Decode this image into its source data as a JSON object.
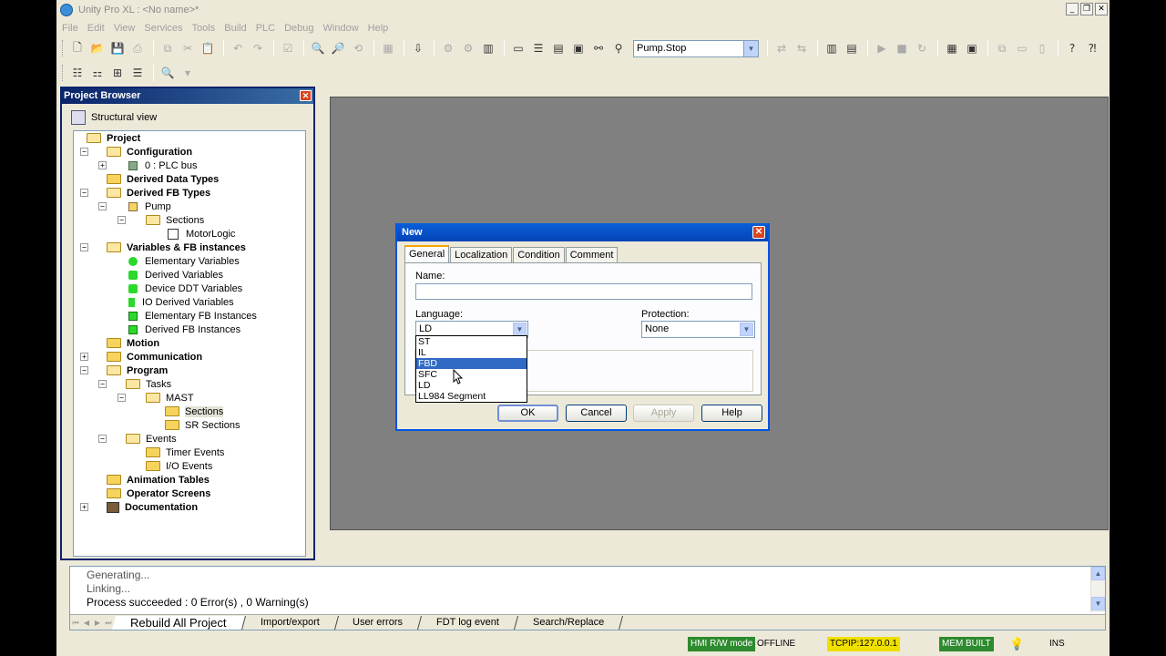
{
  "window": {
    "title": "Unity Pro XL : <No name>*"
  },
  "menu": [
    "File",
    "Edit",
    "View",
    "Services",
    "Tools",
    "Build",
    "PLC",
    "Debug",
    "Window",
    "Help"
  ],
  "toolbar": {
    "combo_value": "Pump.Stop"
  },
  "project_browser": {
    "title": "Project Browser",
    "view_label": "Structural view",
    "tree": [
      {
        "label": "Project",
        "bold": true
      },
      {
        "label": "Configuration",
        "bold": true
      },
      {
        "label": "0 : PLC bus",
        "bold": false
      },
      {
        "label": "Derived Data Types",
        "bold": true
      },
      {
        "label": "Derived FB Types",
        "bold": true
      },
      {
        "label": "Pump",
        "bold": false
      },
      {
        "label": "Sections",
        "bold": false
      },
      {
        "label": "MotorLogic",
        "bold": false
      },
      {
        "label": "Variables & FB instances",
        "bold": true
      },
      {
        "label": "Elementary Variables",
        "bold": false
      },
      {
        "label": "Derived Variables",
        "bold": false
      },
      {
        "label": "Device DDT Variables",
        "bold": false
      },
      {
        "label": "IO Derived Variables",
        "bold": false
      },
      {
        "label": "Elementary FB Instances",
        "bold": false
      },
      {
        "label": "Derived FB Instances",
        "bold": false
      },
      {
        "label": "Motion",
        "bold": true
      },
      {
        "label": "Communication",
        "bold": true
      },
      {
        "label": "Program",
        "bold": true
      },
      {
        "label": "Tasks",
        "bold": false
      },
      {
        "label": "MAST",
        "bold": false
      },
      {
        "label": "Sections",
        "bold": false
      },
      {
        "label": "SR Sections",
        "bold": false
      },
      {
        "label": "Events",
        "bold": false
      },
      {
        "label": "Timer Events",
        "bold": false
      },
      {
        "label": "I/O Events",
        "bold": false
      },
      {
        "label": "Animation Tables",
        "bold": true
      },
      {
        "label": "Operator Screens",
        "bold": true
      },
      {
        "label": "Documentation",
        "bold": true
      }
    ]
  },
  "dialog": {
    "title": "New",
    "tabs": [
      "General",
      "Localization",
      "Condition",
      "Comment"
    ],
    "name_label": "Name:",
    "name_value": "",
    "language_label": "Language:",
    "language_value": "LD",
    "language_options": [
      "ST",
      "IL",
      "FBD",
      "SFC",
      "LD",
      "LL984 Segment"
    ],
    "highlighted_option": "FBD",
    "protection_label": "Protection:",
    "protection_value": "None",
    "buttons": {
      "ok": "OK",
      "cancel": "Cancel",
      "apply": "Apply",
      "help": "Help"
    }
  },
  "output": {
    "lines": [
      "Generating...",
      "Linking...",
      "Process succeeded : 0 Error(s) , 0 Warning(s)"
    ],
    "tabs": [
      "Rebuild All Project",
      "Import/export",
      "User errors",
      "FDT log event",
      "Search/Replace"
    ]
  },
  "status": {
    "hmi_mode": "HMI R/W mode",
    "connection": "OFFLINE",
    "address": "TCPIP:127.0.0.1",
    "mem": "MEM",
    "built": "BUILT",
    "ins": "INS"
  },
  "colors": {
    "accent": "#0a246a",
    "workspace": "#808080",
    "selection": "#316ac5",
    "status_green": "#2d8a2d",
    "status_yellow": "#f0e000"
  }
}
